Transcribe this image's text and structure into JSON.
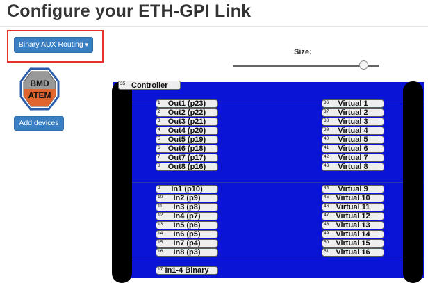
{
  "page": {
    "title": "Configure your ETH-GPI Link"
  },
  "routing_button": {
    "label": "Binary AUX Routing",
    "caret": "▾"
  },
  "device": {
    "line1": "BMD",
    "line2": "ATEM",
    "icon": "bmd-atem-device-icon"
  },
  "add_devices_button": {
    "label": "Add devices"
  },
  "size_slider": {
    "label": "Size:",
    "value": 0.9
  },
  "controller": {
    "number": "35",
    "label": "Controller"
  },
  "left_pins": [
    {
      "num": "1",
      "label": "Out1 (p23)"
    },
    {
      "num": "2",
      "label": "Out2 (p22)"
    },
    {
      "num": "3",
      "label": "Out3 (p21)"
    },
    {
      "num": "4",
      "label": "Out4 (p20)"
    },
    {
      "num": "5",
      "label": "Out5 (p19)"
    },
    {
      "num": "6",
      "label": "Out6 (p18)"
    },
    {
      "num": "7",
      "label": "Out7 (p17)"
    },
    {
      "num": "8",
      "label": "Out8 (p16)"
    },
    {
      "num": "9",
      "label": "In1 (p10)"
    },
    {
      "num": "10",
      "label": "In2 (p9)"
    },
    {
      "num": "11",
      "label": "In3 (p8)"
    },
    {
      "num": "12",
      "label": "In4 (p7)"
    },
    {
      "num": "13",
      "label": "In5 (p6)"
    },
    {
      "num": "14",
      "label": "In6 (p5)"
    },
    {
      "num": "15",
      "label": "In7 (p4)"
    },
    {
      "num": "16",
      "label": "In8 (p3)"
    },
    {
      "num": "17",
      "label": "In1-4 Binary"
    }
  ],
  "right_pins": [
    {
      "num": "36",
      "label": "Virtual 1"
    },
    {
      "num": "37",
      "label": "Virtual 2"
    },
    {
      "num": "38",
      "label": "Virtual 3"
    },
    {
      "num": "39",
      "label": "Virtual 4"
    },
    {
      "num": "40",
      "label": "Virtual 5"
    },
    {
      "num": "41",
      "label": "Virtual 6"
    },
    {
      "num": "42",
      "label": "Virtual 7"
    },
    {
      "num": "43",
      "label": "Virtual 8"
    },
    {
      "num": "44",
      "label": "Virtual 9"
    },
    {
      "num": "45",
      "label": "Virtual 10"
    },
    {
      "num": "46",
      "label": "Virtual 11"
    },
    {
      "num": "47",
      "label": "Virtual 12"
    },
    {
      "num": "48",
      "label": "Virtual 13"
    },
    {
      "num": "49",
      "label": "Virtual 14"
    },
    {
      "num": "50",
      "label": "Virtual 15"
    },
    {
      "num": "51",
      "label": "Virtual 16"
    }
  ],
  "colors": {
    "panel": "#0a14d6",
    "button": "#3a7fc2",
    "highlight": "#e8312a",
    "device_orange": "#e0652e"
  }
}
